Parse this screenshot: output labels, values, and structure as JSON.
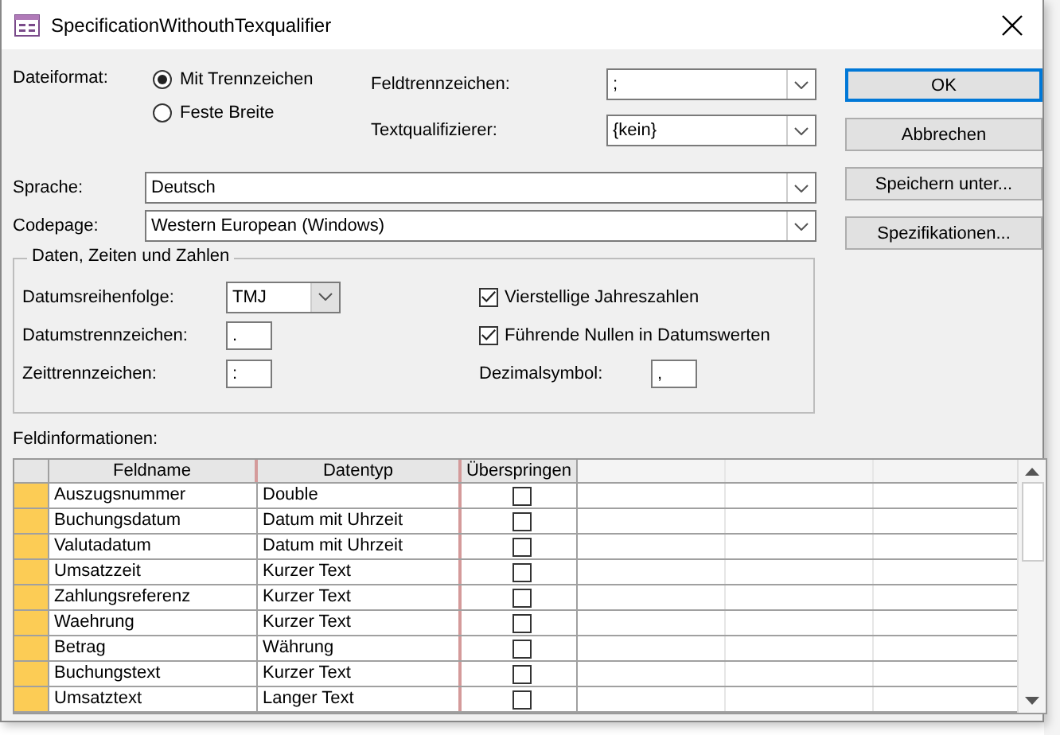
{
  "window": {
    "title": "SpecificationWithouthTexqualifier"
  },
  "file_format": {
    "label": "Dateiformat:",
    "options": [
      {
        "label": "Mit Trennzeichen",
        "selected": true
      },
      {
        "label": "Feste Breite",
        "selected": false
      }
    ]
  },
  "field_delimiter": {
    "label": "Feldtrennzeichen:",
    "value": ";"
  },
  "text_qualifier": {
    "label": "Textqualifizierer:",
    "value": "{kein}"
  },
  "language": {
    "label": "Sprache:",
    "value": "Deutsch"
  },
  "codepage": {
    "label": "Codepage:",
    "value": "Western European (Windows)"
  },
  "buttons": [
    {
      "label": "OK",
      "default": true
    },
    {
      "label": "Abbrechen",
      "default": false
    },
    {
      "label": "Speichern unter...",
      "default": false
    },
    {
      "label": "Spezifikationen...",
      "default": false
    }
  ],
  "dates_group": {
    "title": "Daten, Zeiten und Zahlen",
    "date_order": {
      "label": "Datumsreihenfolge:",
      "value": "TMJ"
    },
    "date_delimiter": {
      "label": "Datumstrennzeichen:",
      "value": "."
    },
    "time_delimiter": {
      "label": "Zeittrennzeichen:",
      "value": ":"
    },
    "four_digit_years": {
      "label": "Vierstellige Jahreszahlen",
      "checked": true
    },
    "leading_zeros": {
      "label": "Führende Nullen in Datumswerten",
      "checked": true
    },
    "decimal_symbol": {
      "label": "Dezimalsymbol:",
      "value": ","
    }
  },
  "field_info": {
    "label": "Feldinformationen:",
    "columns": [
      "Feldname",
      "Datentyp",
      "Überspringen"
    ],
    "rows": [
      {
        "name": "Auszugsnummer",
        "type": "Double",
        "skip": false
      },
      {
        "name": "Buchungsdatum",
        "type": "Datum mit Uhrzeit",
        "skip": false
      },
      {
        "name": "Valutadatum",
        "type": "Datum mit Uhrzeit",
        "skip": false
      },
      {
        "name": "Umsatzzeit",
        "type": "Kurzer Text",
        "skip": false
      },
      {
        "name": "Zahlungsreferenz",
        "type": "Kurzer Text",
        "skip": false
      },
      {
        "name": "Waehrung",
        "type": "Kurzer Text",
        "skip": false
      },
      {
        "name": "Betrag",
        "type": "Währung",
        "skip": false
      },
      {
        "name": "Buchungstext",
        "type": "Kurzer Text",
        "skip": false
      },
      {
        "name": "Umsatztext",
        "type": "Langer Text",
        "skip": false
      }
    ]
  }
}
